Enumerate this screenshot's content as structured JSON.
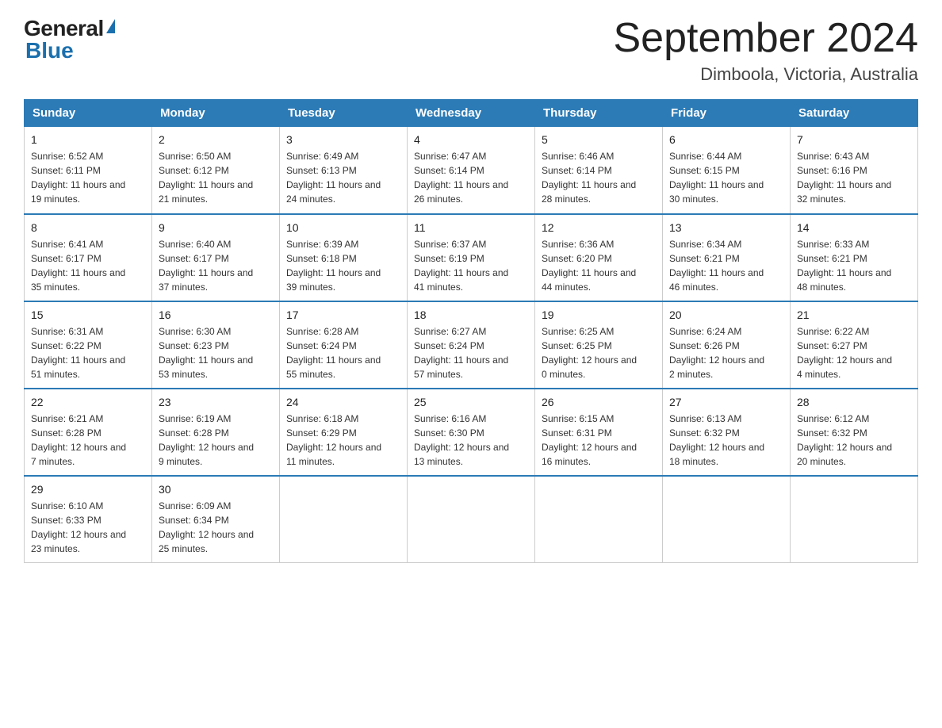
{
  "logo": {
    "text_general": "General",
    "triangle": "▲",
    "text_blue": "Blue"
  },
  "calendar": {
    "title": "September 2024",
    "subtitle": "Dimboola, Victoria, Australia"
  },
  "headers": [
    "Sunday",
    "Monday",
    "Tuesday",
    "Wednesday",
    "Thursday",
    "Friday",
    "Saturday"
  ],
  "weeks": [
    [
      {
        "day": "1",
        "sunrise": "Sunrise: 6:52 AM",
        "sunset": "Sunset: 6:11 PM",
        "daylight": "Daylight: 11 hours and 19 minutes."
      },
      {
        "day": "2",
        "sunrise": "Sunrise: 6:50 AM",
        "sunset": "Sunset: 6:12 PM",
        "daylight": "Daylight: 11 hours and 21 minutes."
      },
      {
        "day": "3",
        "sunrise": "Sunrise: 6:49 AM",
        "sunset": "Sunset: 6:13 PM",
        "daylight": "Daylight: 11 hours and 24 minutes."
      },
      {
        "day": "4",
        "sunrise": "Sunrise: 6:47 AM",
        "sunset": "Sunset: 6:14 PM",
        "daylight": "Daylight: 11 hours and 26 minutes."
      },
      {
        "day": "5",
        "sunrise": "Sunrise: 6:46 AM",
        "sunset": "Sunset: 6:14 PM",
        "daylight": "Daylight: 11 hours and 28 minutes."
      },
      {
        "day": "6",
        "sunrise": "Sunrise: 6:44 AM",
        "sunset": "Sunset: 6:15 PM",
        "daylight": "Daylight: 11 hours and 30 minutes."
      },
      {
        "day": "7",
        "sunrise": "Sunrise: 6:43 AM",
        "sunset": "Sunset: 6:16 PM",
        "daylight": "Daylight: 11 hours and 32 minutes."
      }
    ],
    [
      {
        "day": "8",
        "sunrise": "Sunrise: 6:41 AM",
        "sunset": "Sunset: 6:17 PM",
        "daylight": "Daylight: 11 hours and 35 minutes."
      },
      {
        "day": "9",
        "sunrise": "Sunrise: 6:40 AM",
        "sunset": "Sunset: 6:17 PM",
        "daylight": "Daylight: 11 hours and 37 minutes."
      },
      {
        "day": "10",
        "sunrise": "Sunrise: 6:39 AM",
        "sunset": "Sunset: 6:18 PM",
        "daylight": "Daylight: 11 hours and 39 minutes."
      },
      {
        "day": "11",
        "sunrise": "Sunrise: 6:37 AM",
        "sunset": "Sunset: 6:19 PM",
        "daylight": "Daylight: 11 hours and 41 minutes."
      },
      {
        "day": "12",
        "sunrise": "Sunrise: 6:36 AM",
        "sunset": "Sunset: 6:20 PM",
        "daylight": "Daylight: 11 hours and 44 minutes."
      },
      {
        "day": "13",
        "sunrise": "Sunrise: 6:34 AM",
        "sunset": "Sunset: 6:21 PM",
        "daylight": "Daylight: 11 hours and 46 minutes."
      },
      {
        "day": "14",
        "sunrise": "Sunrise: 6:33 AM",
        "sunset": "Sunset: 6:21 PM",
        "daylight": "Daylight: 11 hours and 48 minutes."
      }
    ],
    [
      {
        "day": "15",
        "sunrise": "Sunrise: 6:31 AM",
        "sunset": "Sunset: 6:22 PM",
        "daylight": "Daylight: 11 hours and 51 minutes."
      },
      {
        "day": "16",
        "sunrise": "Sunrise: 6:30 AM",
        "sunset": "Sunset: 6:23 PM",
        "daylight": "Daylight: 11 hours and 53 minutes."
      },
      {
        "day": "17",
        "sunrise": "Sunrise: 6:28 AM",
        "sunset": "Sunset: 6:24 PM",
        "daylight": "Daylight: 11 hours and 55 minutes."
      },
      {
        "day": "18",
        "sunrise": "Sunrise: 6:27 AM",
        "sunset": "Sunset: 6:24 PM",
        "daylight": "Daylight: 11 hours and 57 minutes."
      },
      {
        "day": "19",
        "sunrise": "Sunrise: 6:25 AM",
        "sunset": "Sunset: 6:25 PM",
        "daylight": "Daylight: 12 hours and 0 minutes."
      },
      {
        "day": "20",
        "sunrise": "Sunrise: 6:24 AM",
        "sunset": "Sunset: 6:26 PM",
        "daylight": "Daylight: 12 hours and 2 minutes."
      },
      {
        "day": "21",
        "sunrise": "Sunrise: 6:22 AM",
        "sunset": "Sunset: 6:27 PM",
        "daylight": "Daylight: 12 hours and 4 minutes."
      }
    ],
    [
      {
        "day": "22",
        "sunrise": "Sunrise: 6:21 AM",
        "sunset": "Sunset: 6:28 PM",
        "daylight": "Daylight: 12 hours and 7 minutes."
      },
      {
        "day": "23",
        "sunrise": "Sunrise: 6:19 AM",
        "sunset": "Sunset: 6:28 PM",
        "daylight": "Daylight: 12 hours and 9 minutes."
      },
      {
        "day": "24",
        "sunrise": "Sunrise: 6:18 AM",
        "sunset": "Sunset: 6:29 PM",
        "daylight": "Daylight: 12 hours and 11 minutes."
      },
      {
        "day": "25",
        "sunrise": "Sunrise: 6:16 AM",
        "sunset": "Sunset: 6:30 PM",
        "daylight": "Daylight: 12 hours and 13 minutes."
      },
      {
        "day": "26",
        "sunrise": "Sunrise: 6:15 AM",
        "sunset": "Sunset: 6:31 PM",
        "daylight": "Daylight: 12 hours and 16 minutes."
      },
      {
        "day": "27",
        "sunrise": "Sunrise: 6:13 AM",
        "sunset": "Sunset: 6:32 PM",
        "daylight": "Daylight: 12 hours and 18 minutes."
      },
      {
        "day": "28",
        "sunrise": "Sunrise: 6:12 AM",
        "sunset": "Sunset: 6:32 PM",
        "daylight": "Daylight: 12 hours and 20 minutes."
      }
    ],
    [
      {
        "day": "29",
        "sunrise": "Sunrise: 6:10 AM",
        "sunset": "Sunset: 6:33 PM",
        "daylight": "Daylight: 12 hours and 23 minutes."
      },
      {
        "day": "30",
        "sunrise": "Sunrise: 6:09 AM",
        "sunset": "Sunset: 6:34 PM",
        "daylight": "Daylight: 12 hours and 25 minutes."
      },
      null,
      null,
      null,
      null,
      null
    ]
  ]
}
